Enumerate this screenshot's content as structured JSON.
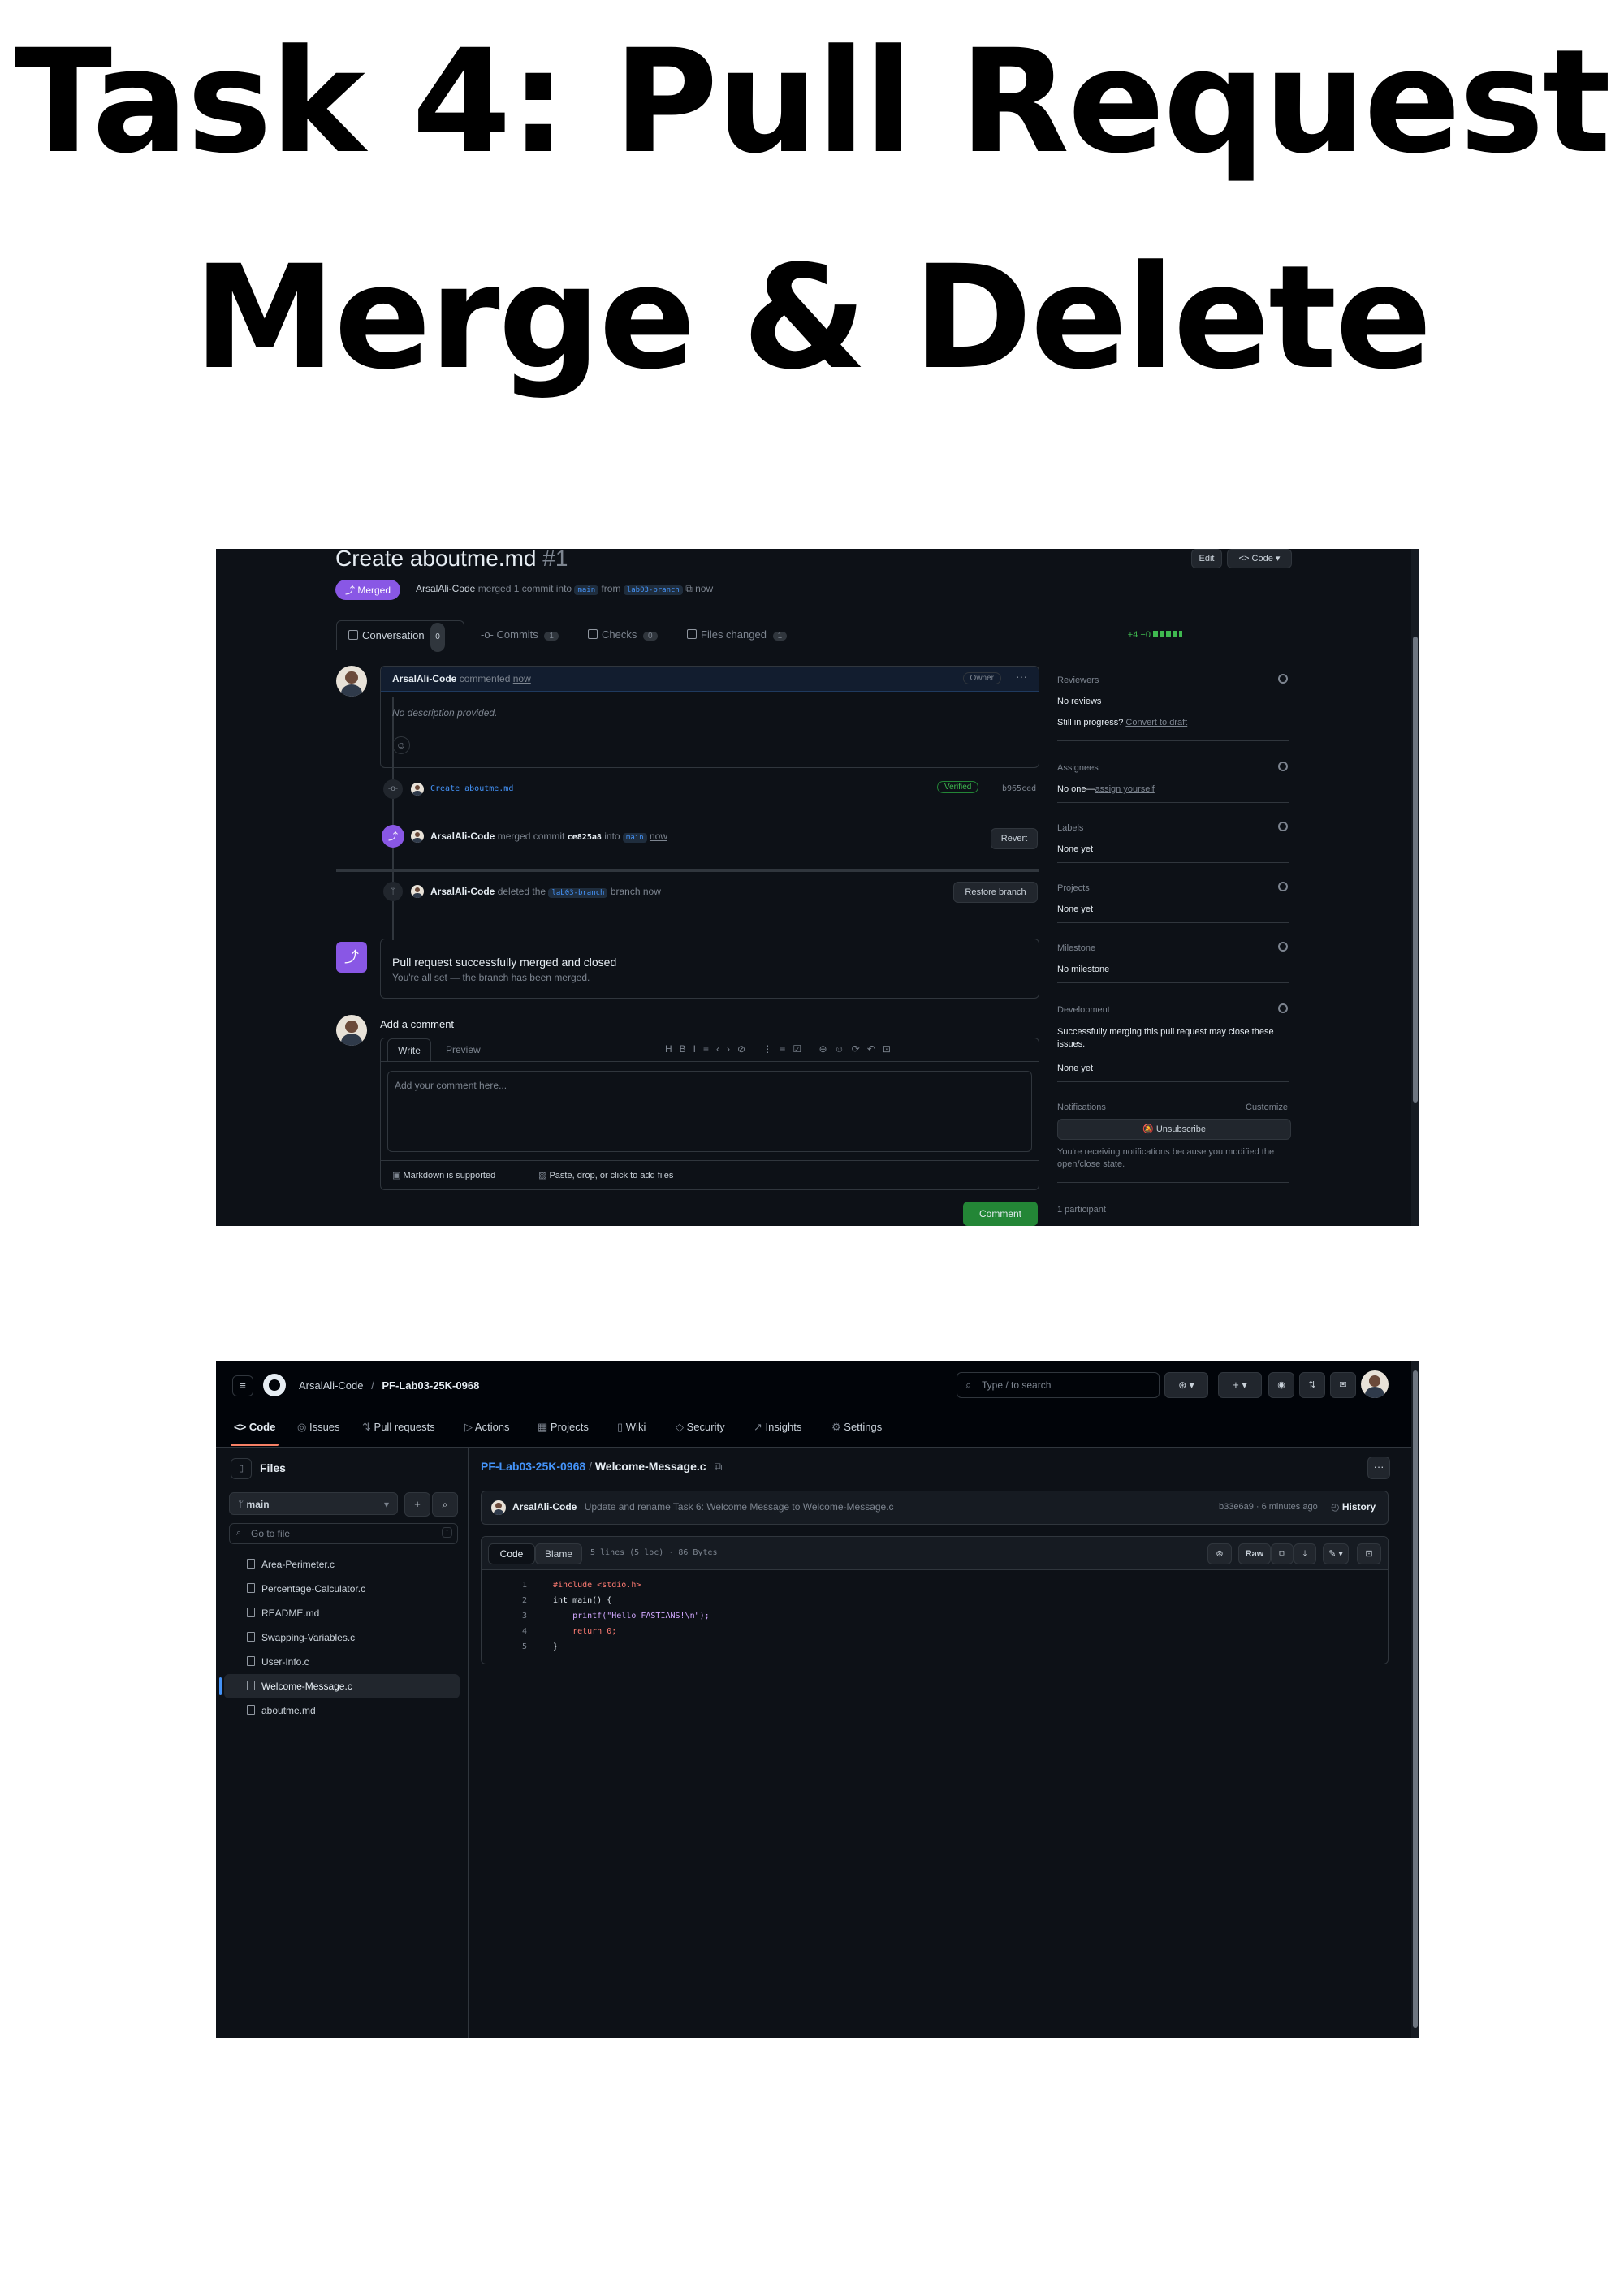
{
  "heading": {
    "line1": "Task 4: Pull Request",
    "line2": "Merge & Delete"
  },
  "pr": {
    "title": "Create aboutme.md",
    "number": "#1",
    "edit": "Edit",
    "code_btn": "<> Code",
    "status": "Merged",
    "meta_author": "ArsalAli-Code",
    "meta_text": "merged 1 commit into",
    "meta_base": "main",
    "meta_from": "from",
    "meta_head": "lab03-branch",
    "meta_time": "now",
    "tabs": [
      {
        "label": "Conversation",
        "count": "0"
      },
      {
        "label": "Commits",
        "count": "1"
      },
      {
        "label": "Checks",
        "count": "0"
      },
      {
        "label": "Files changed",
        "count": "1"
      }
    ],
    "diffstat": "+4 −0",
    "comment": {
      "author": "ArsalAli-Code",
      "action": "commented",
      "time": "now",
      "badge": "Owner",
      "body": "No description provided."
    },
    "commit": {
      "message": "Create aboutme.md",
      "verified": "Verified",
      "sha": "b965ced"
    },
    "merged_event": {
      "author": "ArsalAli-Code",
      "text": "merged commit",
      "sha": "ce825a8",
      "into": "into",
      "base": "main",
      "time": "now",
      "button": "Revert"
    },
    "deleted_event": {
      "author": "ArsalAli-Code",
      "text1": "deleted the",
      "branch": "lab03-branch",
      "text2": "branch",
      "time": "now",
      "button": "Restore branch"
    },
    "merged_box": {
      "title": "Pull request successfully merged and closed",
      "sub": "You're all set — the branch has been merged."
    },
    "add_comment": {
      "heading": "Add a comment",
      "tab_write": "Write",
      "tab_preview": "Preview",
      "placeholder": "Add your comment here...",
      "markdown": "Markdown is supported",
      "paste": "Paste, drop, or click to add files",
      "submit": "Comment"
    },
    "sidebar": {
      "reviewers_h": "Reviewers",
      "reviewers_v": "No reviews",
      "progress_q": "Still in progress?",
      "progress_link": "Convert to draft",
      "assignees_h": "Assignees",
      "assignees_v": "No one—",
      "assignees_link": "assign yourself",
      "labels_h": "Labels",
      "labels_v": "None yet",
      "projects_h": "Projects",
      "projects_v": "None yet",
      "milestone_h": "Milestone",
      "milestone_v": "No milestone",
      "development_h": "Development",
      "development_text": "Successfully merging this pull request may close these issues.",
      "development_v": "None yet",
      "notifications_h": "Notifications",
      "customize": "Customize",
      "unsubscribe": "Unsubscribe",
      "notif_text": "You're receiving notifications because you modified the open/close state.",
      "participants": "1 participant"
    }
  },
  "repo": {
    "owner": "ArsalAli-Code",
    "sep": "/",
    "name": "PF-Lab03-25K-0968",
    "search": "Type / to search",
    "nav": [
      "Code",
      "Issues",
      "Pull requests",
      "Actions",
      "Projects",
      "Wiki",
      "Security",
      "Insights",
      "Settings"
    ],
    "files_heading": "Files",
    "branch": "main",
    "goto": "Go to file",
    "goto_key": "t",
    "files": [
      "Area-Perimeter.c",
      "Percentage-Calculator.c",
      "README.md",
      "Swapping-Variables.c",
      "User-Info.c",
      "Welcome-Message.c",
      "aboutme.md"
    ],
    "active_file_index": 5,
    "breadcrumb_repo": "PF-Lab03-25K-0968",
    "breadcrumb_file": "Welcome-Message.c",
    "commit_author": "ArsalAli-Code",
    "commit_msg": "Update and rename Task 6: Welcome Message to Welcome-Message.c",
    "commit_meta": "b33e6a9 · 6 minutes ago",
    "history": "History",
    "code_tab": "Code",
    "blame_tab": "Blame",
    "file_info": "5 lines (5 loc) · 86 Bytes",
    "raw": "Raw",
    "code_lines": [
      {
        "n": "1",
        "text": "#include <stdio.h>"
      },
      {
        "n": "2",
        "text": "int main() {"
      },
      {
        "n": "3",
        "text": "    printf(\"Hello FASTIANS!\\n\");"
      },
      {
        "n": "4",
        "text": "    return 0;"
      },
      {
        "n": "5",
        "text": "}"
      }
    ]
  },
  "colors": {
    "bg": "#0d1117",
    "merged": "#8957e5",
    "link": "#4493f8",
    "green": "#238636",
    "border": "#30363d"
  }
}
